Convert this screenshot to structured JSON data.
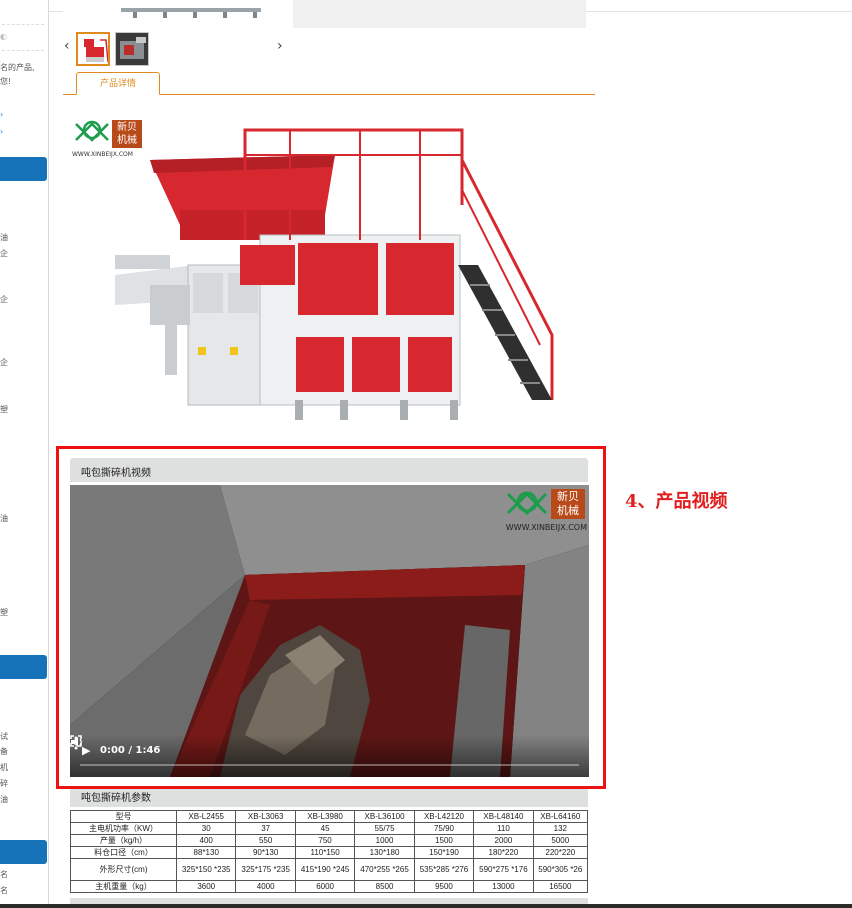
{
  "sidebar": {
    "snippets": [
      "名的产品,",
      "您!",
      "油",
      "企",
      "企",
      "企",
      "塑",
      "油",
      "塑",
      "试",
      "备",
      "机",
      "碎",
      "油",
      "名",
      "名"
    ]
  },
  "gallery": {
    "prev_label": "‹",
    "next_label": "›"
  },
  "tabs": {
    "product_detail": "产品详情"
  },
  "brand": {
    "name_line1": "新贝",
    "name_line2": "机械",
    "url": "WWW.XINBEIJX.COM"
  },
  "video_section": {
    "title": "吨包撕碎机视频",
    "time": "0:00 / 1:46",
    "progress": 0.0,
    "overlay_logo_line1": "新贝",
    "overlay_logo_line2": "机械",
    "overlay_url": "WWW.XINBEIJX.COM"
  },
  "annotation": {
    "label": "4、产品视频",
    "color": "#e01f1f"
  },
  "params_section": {
    "title": "吨包撕碎机参数",
    "headers": [
      "型号",
      "XB-L2455",
      "XB-L3063",
      "XB-L3980",
      "XB-L36100",
      "XB-L42120",
      "XB-L48140",
      "XB-L64160"
    ],
    "rows": [
      [
        "主电机功率（KW）",
        "30",
        "37",
        "45",
        "55/75",
        "75/90",
        "110",
        "132"
      ],
      [
        "产量（kg/h）",
        "400",
        "550",
        "750",
        "1000",
        "1500",
        "2000",
        "5000"
      ],
      [
        "料仓口径（cm）",
        "88*130",
        "90*130",
        "110*150",
        "130*180",
        "150*190",
        "180*220",
        "220*220"
      ],
      [
        "外形尺寸(cm)",
        "325*150 *235",
        "325*175 *235",
        "415*190 *245",
        "470*255 *265",
        "535*285 *276",
        "590*275 *176",
        "590*305 *26"
      ],
      [
        "主机重量（kg）",
        "3600",
        "4000",
        "6000",
        "8500",
        "9500",
        "13000",
        "16500"
      ]
    ]
  },
  "colors": {
    "accent_orange": "#e08a1e",
    "highlight_red": "#ee1111",
    "sidebar_blue": "#1673b9",
    "machine_red": "#d7282f"
  }
}
